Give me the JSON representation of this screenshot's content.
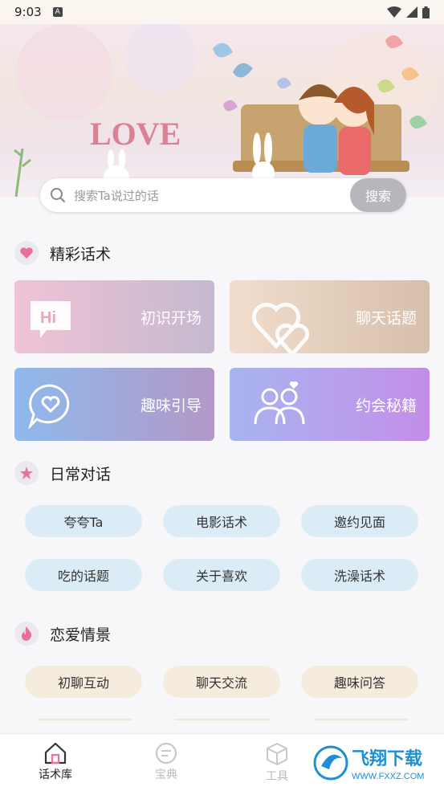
{
  "status_bar": {
    "time": "9:03"
  },
  "search": {
    "placeholder": "搜索Ta说过的话",
    "button_label": "搜索"
  },
  "banner": {
    "art_text": "LOVE"
  },
  "sections": {
    "featured": {
      "title": "精彩话术",
      "cards": [
        {
          "label": "初识开场",
          "icon_text": "Hi"
        },
        {
          "label": "聊天话题"
        },
        {
          "label": "趣味引导"
        },
        {
          "label": "约会秘籍"
        }
      ]
    },
    "daily": {
      "title": "日常对话",
      "pills": [
        "夸夸Ta",
        "电影话术",
        "邀约见面",
        "吃的话题",
        "关于喜欢",
        "洗澡话术"
      ]
    },
    "love": {
      "title": "恋爱情景",
      "pills": [
        "初聊互动",
        "聊天交流",
        "趣味问答"
      ]
    }
  },
  "tabbar": {
    "tabs": [
      {
        "label": "话术库",
        "active": true
      },
      {
        "label": "宝典",
        "active": false
      },
      {
        "label": "工具",
        "active": false
      }
    ]
  },
  "watermark": {
    "brand": "飞翔下载",
    "url": "WWW.FXXZ.COM"
  },
  "colors": {
    "accent_pink": "#e8719a",
    "pill_blue": "#dcecf6",
    "pill_beige": "#f5ecde"
  }
}
